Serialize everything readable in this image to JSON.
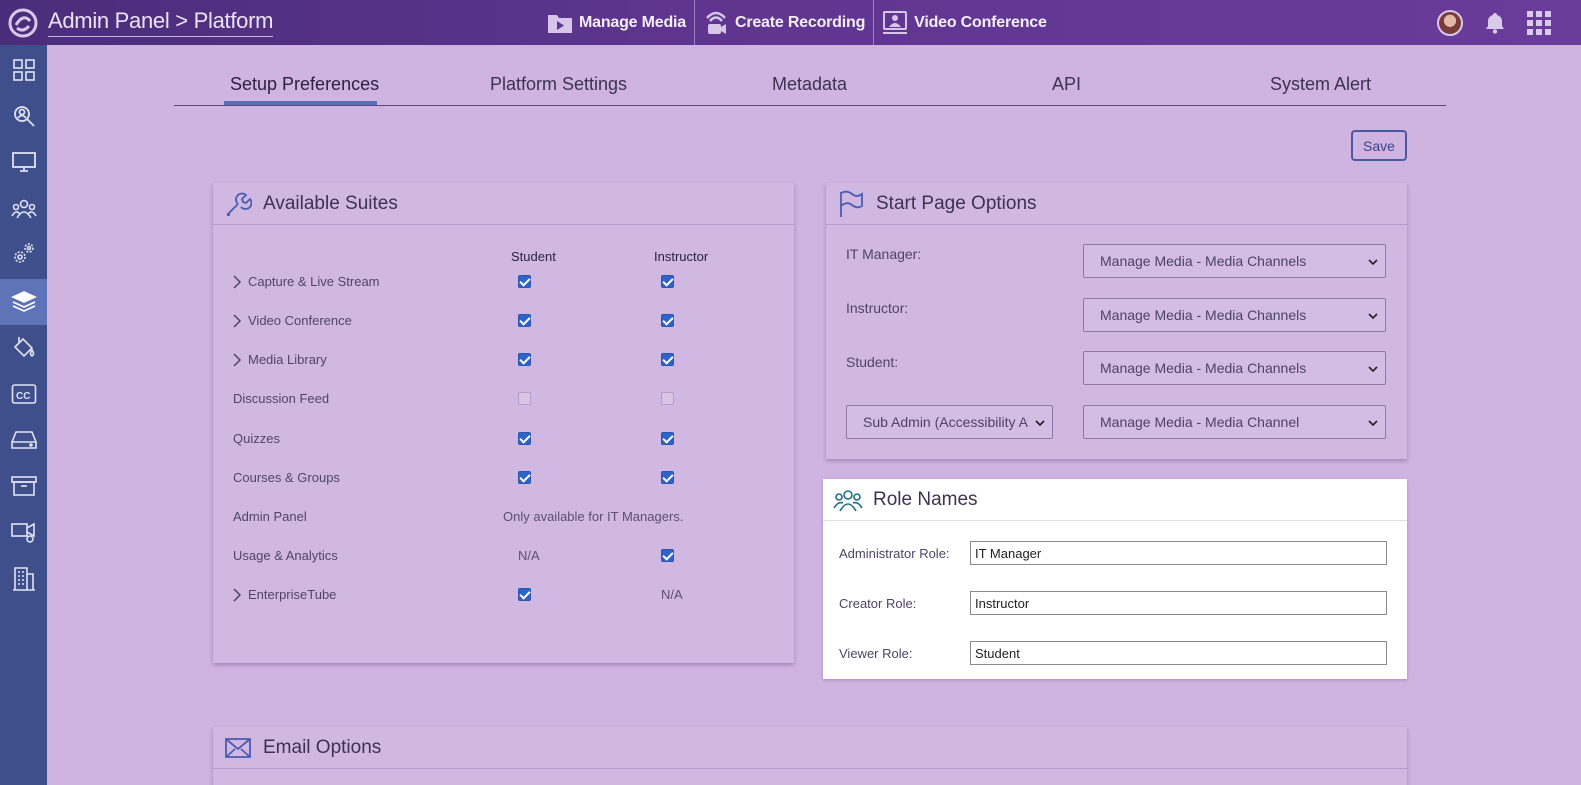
{
  "header": {
    "title": "Admin Panel > Platform",
    "nav": [
      {
        "label": "Manage Media",
        "icon": "media-folder-icon"
      },
      {
        "label": "Create Recording",
        "icon": "recording-icon"
      },
      {
        "label": "Video Conference",
        "icon": "video-conference-icon"
      }
    ]
  },
  "sidebar": {
    "items": [
      {
        "icon": "dashboard-icon"
      },
      {
        "icon": "search-users-icon"
      },
      {
        "icon": "monitor-icon"
      },
      {
        "icon": "group-icon"
      },
      {
        "icon": "settings-gears-icon"
      },
      {
        "icon": "layers-icon",
        "active": true
      },
      {
        "icon": "paint-bucket-icon"
      },
      {
        "icon": "closed-captions-icon"
      },
      {
        "icon": "drive-icon"
      },
      {
        "icon": "archive-icon"
      },
      {
        "icon": "video-settings-icon"
      },
      {
        "icon": "building-icon"
      }
    ]
  },
  "tabs": [
    "Setup Preferences",
    "Platform Settings",
    "Metadata",
    "API",
    "System Alert"
  ],
  "save_label": "Save",
  "suites": {
    "title": "Available Suites",
    "col_student": "Student",
    "col_instructor": "Instructor",
    "rows": [
      {
        "name": "Capture & Live Stream",
        "expandable": true,
        "student": "checked",
        "instructor": "checked"
      },
      {
        "name": "Video Conference",
        "expandable": true,
        "student": "checked",
        "instructor": "checked"
      },
      {
        "name": "Media Library",
        "expandable": true,
        "student": "checked",
        "instructor": "checked"
      },
      {
        "name": "Discussion Feed",
        "expandable": false,
        "student": "disabled",
        "instructor": "disabled"
      },
      {
        "name": "Quizzes",
        "expandable": false,
        "student": "checked",
        "instructor": "checked"
      },
      {
        "name": "Courses & Groups",
        "expandable": false,
        "student": "checked",
        "instructor": "checked"
      },
      {
        "name": "Admin Panel",
        "expandable": false,
        "note": "Only available for IT Managers."
      },
      {
        "name": "Usage & Analytics",
        "expandable": false,
        "student": "N/A",
        "instructor": "checked"
      },
      {
        "name": "EnterpriseTube",
        "expandable": true,
        "student": "checked",
        "instructor": "N/A"
      }
    ]
  },
  "start_page": {
    "title": "Start Page Options",
    "rows": [
      {
        "label": "IT Manager:",
        "value": "Manage Media - Media Channels"
      },
      {
        "label": "Instructor:",
        "value": "Manage Media - Media Channels"
      },
      {
        "label": "Student:",
        "value": "Manage Media - Media Channels"
      }
    ],
    "sub_admin_select": "Sub Admin (Accessibility A",
    "sub_admin_value": "Manage Media - Media Channel"
  },
  "roles": {
    "title": "Role Names",
    "rows": [
      {
        "label": "Administrator Role:",
        "value": "IT Manager"
      },
      {
        "label": "Creator Role:",
        "value": "Instructor"
      },
      {
        "label": "Viewer Role:",
        "value": "Student"
      }
    ]
  },
  "email": {
    "title": "Email Options"
  }
}
